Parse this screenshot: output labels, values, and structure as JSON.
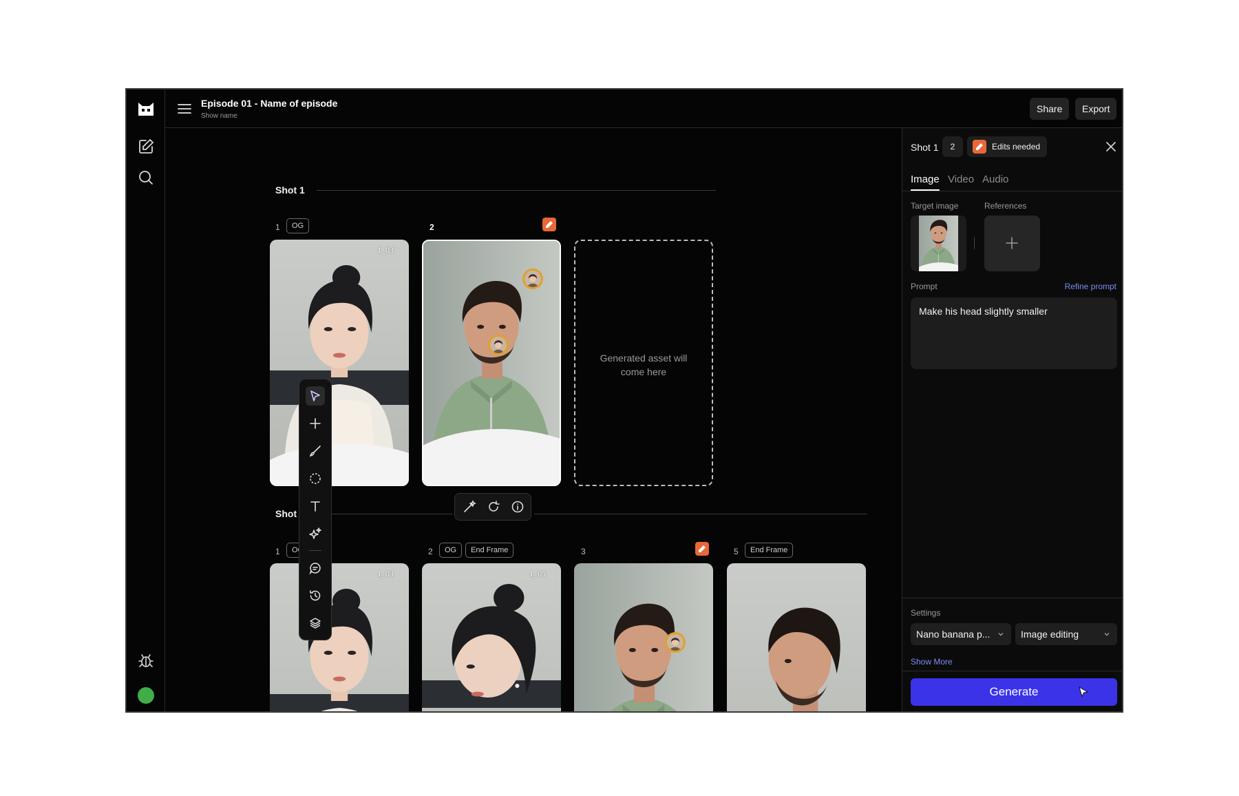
{
  "header": {
    "episode_title": "Episode 01 - Name of episode",
    "show_name": "Show name",
    "share_label": "Share",
    "export_label": "Export"
  },
  "canvas": {
    "shots": [
      {
        "title": "Shot 1",
        "frames": [
          {
            "number": "1",
            "tags": [
              "OG"
            ],
            "image_label": "1_03",
            "subject": "woman"
          },
          {
            "number": "2",
            "tags": [],
            "edit_badge": true,
            "selected": true,
            "subject": "man-sweater"
          },
          {
            "placeholder": "Generated asset will come here"
          }
        ]
      },
      {
        "title": "Shot 2",
        "frames": [
          {
            "number": "1",
            "tags": [
              "OG"
            ],
            "image_label": "1_03",
            "subject": "woman"
          },
          {
            "number": "2",
            "tags": [
              "OG",
              "End Frame"
            ],
            "image_label": "1_05",
            "subject": "woman-side"
          },
          {
            "number": "3",
            "tags": [],
            "edit_badge": true,
            "subject": "man-sweater"
          },
          {
            "number": "5",
            "tags": [
              "End Frame"
            ],
            "subject": "man-profile"
          }
        ]
      }
    ]
  },
  "panel": {
    "shot_label": "Shot 1",
    "count": "2",
    "status": "Edits needed",
    "tabs": [
      "Image",
      "Video",
      "Audio"
    ],
    "active_tab": "Image",
    "target_image_label": "Target image",
    "references_label": "References",
    "prompt_label": "Prompt",
    "refine_label": "Refine prompt",
    "prompt_text": "Make his head slightly smaller",
    "settings_label": "Settings",
    "model": "Nano banana p...",
    "mode": "Image editing",
    "show_more": "Show More",
    "generate_label": "Generate"
  },
  "colors": {
    "accent": "#3b33e8",
    "edit_badge": "#e8683a",
    "character_badge": "#e2a12b",
    "online": "#3fae49",
    "link": "#7e8cf4"
  }
}
